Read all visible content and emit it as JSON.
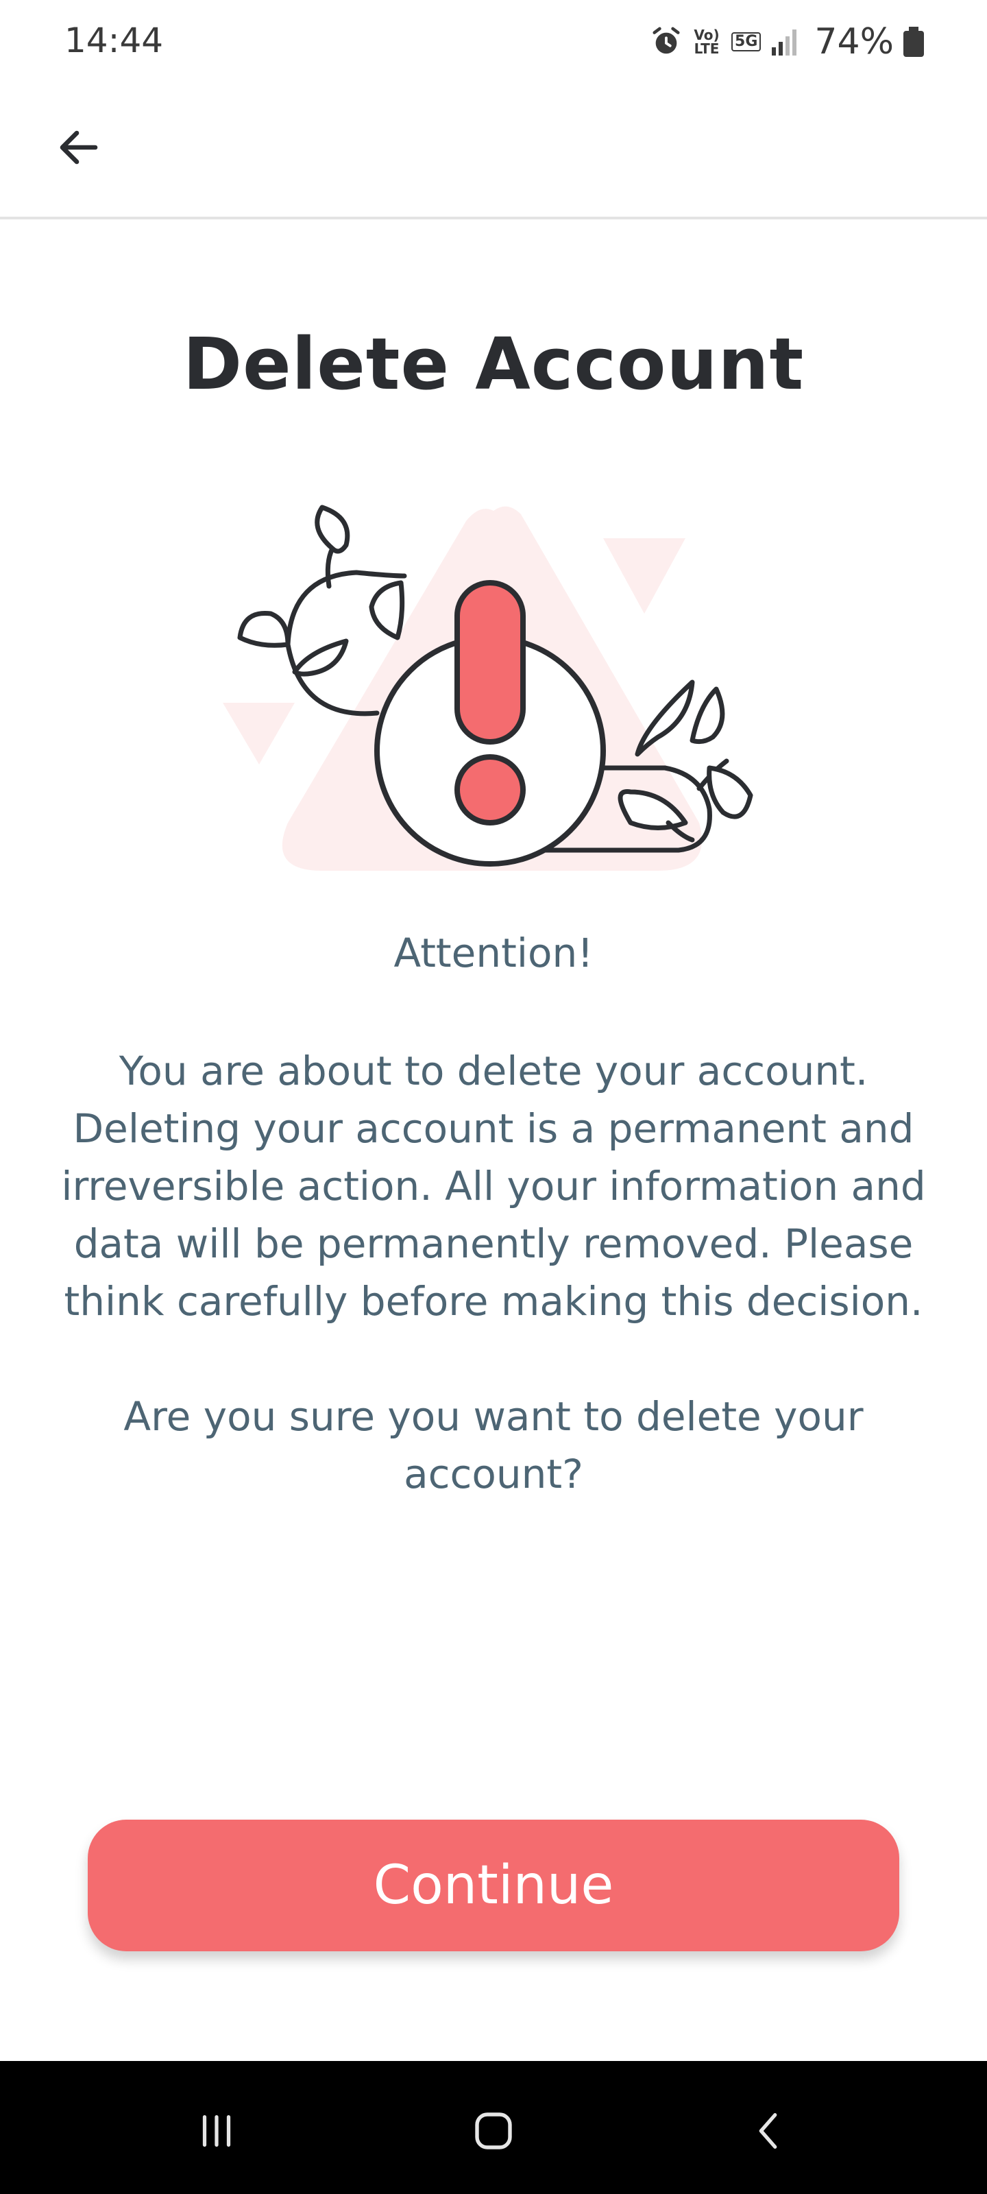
{
  "status_bar": {
    "time": "14:44",
    "battery": "74%",
    "volte_label": "Vo) LTE",
    "network_label": "5G",
    "icons": [
      "alarm-icon",
      "volte-icon",
      "5g-icon",
      "signal-icon",
      "battery-icon"
    ]
  },
  "app_bar": {
    "back_icon": "arrow-left-icon"
  },
  "page": {
    "title": "Delete Account",
    "illustration": "warning-exclamation-with-vines",
    "attention": "Attention!",
    "body": "You are about to delete your account. Deleting your account is a permanent and irreversible action. All your information and data will be permanently removed. Please think carefully before making this decision.",
    "question": "Are you sure you want to delete your account?",
    "continue_label": "Continue"
  },
  "nav_bar": {
    "icons": [
      "recent-apps-icon",
      "home-icon",
      "back-icon"
    ]
  },
  "colors": {
    "accent": "#f46c6f",
    "accent_light": "#fdeeee",
    "text_dark": "#2b2d31",
    "text_muted": "#4d6574"
  }
}
